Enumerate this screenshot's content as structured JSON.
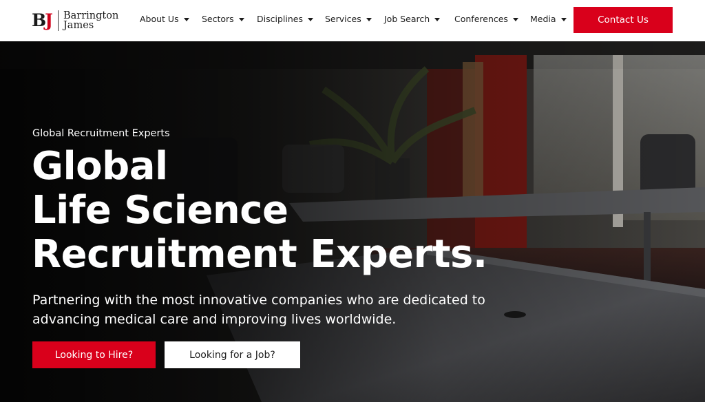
{
  "brand": {
    "monogram_b": "B",
    "monogram_j": "J",
    "name_line1": "Barrington",
    "name_line2": "James",
    "accent_color": "#d9001b"
  },
  "nav": {
    "items": [
      {
        "label": "About Us",
        "icon": "caret-down-icon"
      },
      {
        "label": "Sectors",
        "icon": "caret-down-icon"
      },
      {
        "label": "Disciplines",
        "icon": "caret-down-icon"
      },
      {
        "label": "Services",
        "icon": "caret-down-icon"
      },
      {
        "label": "Job Search",
        "icon": "caret-down-icon"
      },
      {
        "label": "Conferences",
        "icon": "caret-down-icon"
      },
      {
        "label": "Media",
        "icon": "caret-down-icon"
      }
    ],
    "contact_label": "Contact Us"
  },
  "hero": {
    "eyebrow": "Global Recruitment Experts",
    "title_lines": [
      "Global",
      "Life Science",
      "Recruitment Experts."
    ],
    "subtitle_lines": [
      "Partnering with the most innovative companies who are dedicated to",
      "advancing medical care and improving lives worldwide."
    ],
    "primary_cta": "Looking to Hire?",
    "secondary_cta": "Looking for a Job?"
  }
}
